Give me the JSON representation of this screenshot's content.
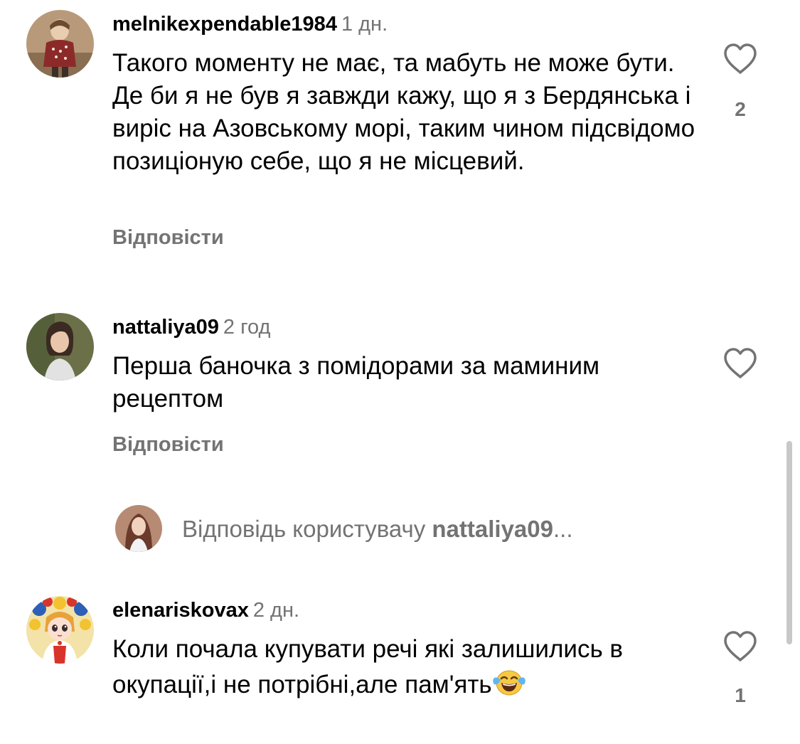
{
  "comments": [
    {
      "username": "melnikexpendable1984",
      "time": "1 дн.",
      "text": "Такого моменту не має, та мабуть не може бути. Де би я не був я завжди кажу, що я з Бердянська і виріс на Азовському морі, таким чином підсвідомо позиціоную себе, що я не місцевий.",
      "reply_label": "Відповісти",
      "likes": "2",
      "like_icon": "heart-outline-icon"
    },
    {
      "username": "nattaliya09",
      "time": "2 год",
      "text": "Перша баночка з помідорами за маминим рецептом",
      "reply_label": "Відповісти",
      "likes": "",
      "like_icon": "heart-outline-icon"
    },
    {
      "username": "elenariskovax",
      "time": "2 дн.",
      "text": "Коли почала купувати речі які залишились в окупації,і не потрібні,але пам'ять",
      "emoji": "face-with-tears-of-joy",
      "likes": "1",
      "like_icon": "heart-outline-icon"
    }
  ],
  "reply_prompt": {
    "prefix": "Відповідь користувачу ",
    "username": "nattaliya09",
    "suffix": "..."
  },
  "colors": {
    "text": "#000000",
    "secondary": "#737373",
    "scrollbar": "#c8c8c8"
  }
}
